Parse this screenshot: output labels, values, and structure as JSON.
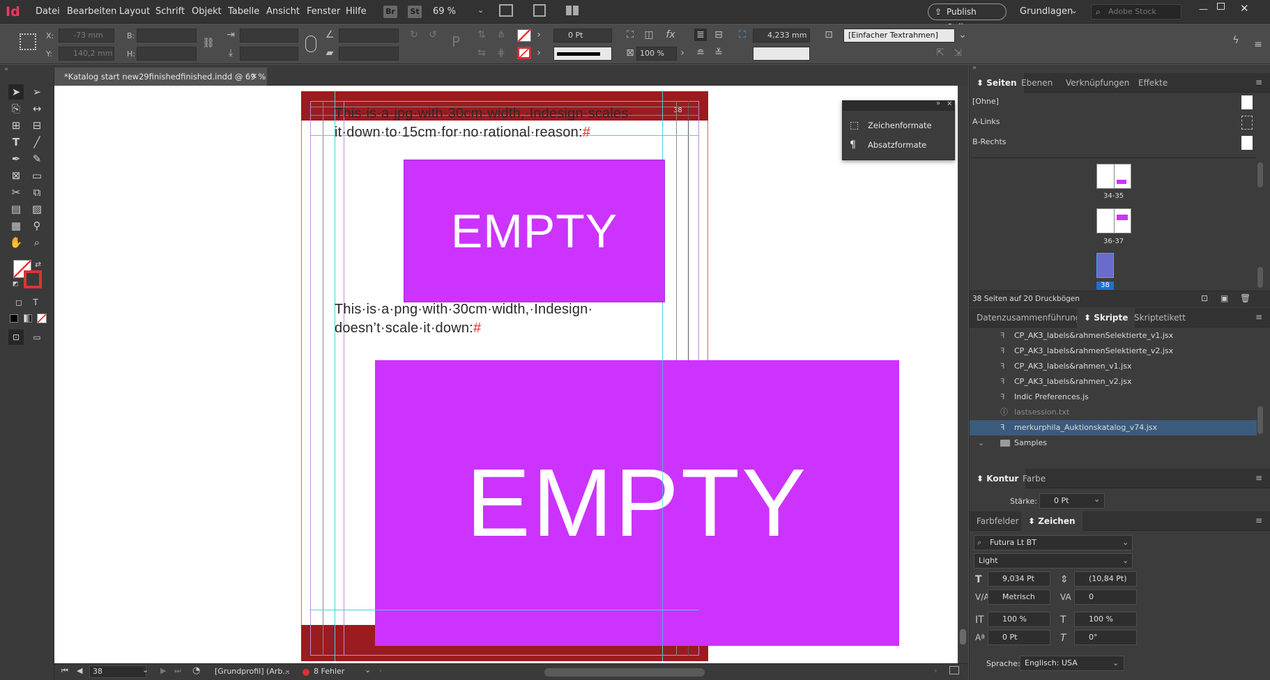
{
  "menubar": {
    "logo": "Id",
    "menus": [
      "Datei",
      "Bearbeiten",
      "Layout",
      "Schrift",
      "Objekt",
      "Tabelle",
      "Ansicht",
      "Fenster",
      "Hilfe"
    ],
    "br_badge": "Br",
    "st_badge": "St",
    "zoom": "69 %",
    "publish_online": "Publish Online",
    "workspace": "Grundlagen",
    "search_placeholder": "Adobe Stock"
  },
  "control": {
    "x_label": "X:",
    "x_value": "-73 mm",
    "y_label": "Y:",
    "y_value": "140,2 mm",
    "b_label": "B:",
    "h_label": "H:",
    "stroke_weight": "0 Pt",
    "opacity": "100 %",
    "gap": "4,233 mm",
    "frame_style": "[Einfacher Textrahmen]"
  },
  "document": {
    "tab_title": "*Katalog start new29finishedfinished.indd @ 69 %",
    "page_number_label": "38",
    "text1_line1": "This·is·a·jpg·with·30cm·width,·Indesign·scales·",
    "text1_line2": "it·down·to·15cm·for·no·rational·reason:",
    "text2_line1": "This·is·a·png·with·30cm·width,·Indesign·",
    "text2_line2": "doesn’t·scale·it·down:",
    "end_marker": "#",
    "placeholder_small": "EMPTY",
    "placeholder_large": "EMPTY"
  },
  "floating_panel": {
    "items": [
      "Zeichenformate",
      "Absatzformate"
    ]
  },
  "status": {
    "page": "38",
    "profile": "[Grundprofil] (Arb...",
    "errors": "8 Fehler"
  },
  "pages_panel": {
    "tabs": [
      "Seiten",
      "Ebenen",
      "Verknüpfungen",
      "Effekte"
    ],
    "masters": [
      "[Ohne]",
      "A-Links",
      "B-Rechts"
    ],
    "spreads": [
      "34-35",
      "36-37",
      "38"
    ],
    "footer": "38 Seiten auf 20 Druckbögen"
  },
  "scripts_panel": {
    "tabs": [
      "Datenzusammenführung",
      "Skripte",
      "Skriptetikett"
    ],
    "items": [
      "CP_AK3_labels&rahmenSelektierte_v1.jsx",
      "CP_AK3_labels&rahmenSelektierte_v2.jsx",
      "CP_AK3_labels&rahmen_v1.jsx",
      "CP_AK3_labels&rahmen_v2.jsx",
      "Indic Preferences.js",
      "lastsession.txt",
      "merkurphila_Auktionskatalog_v74.jsx",
      "Samples"
    ]
  },
  "stroke_panel": {
    "tabs": [
      "Kontur",
      "Farbe"
    ],
    "weight_label": "Stärke:",
    "weight_value": "0 Pt"
  },
  "character_panel": {
    "tabs": [
      "Farbfelder",
      "Zeichen"
    ],
    "font": "Futura Lt BT",
    "style": "Light",
    "size": "9,034 Pt",
    "leading": "(10,84 Pt)",
    "kerning": "Metrisch",
    "tracking": "0",
    "vscale": "100 %",
    "hscale": "100 %",
    "baseline": "0 Pt",
    "skew": "0°",
    "language_label": "Sprache:",
    "language": "Englisch: USA"
  },
  "colors": {
    "accent": "#cc33ff",
    "page_band": "#9b1c1f",
    "selection": "#3b5b7c"
  }
}
